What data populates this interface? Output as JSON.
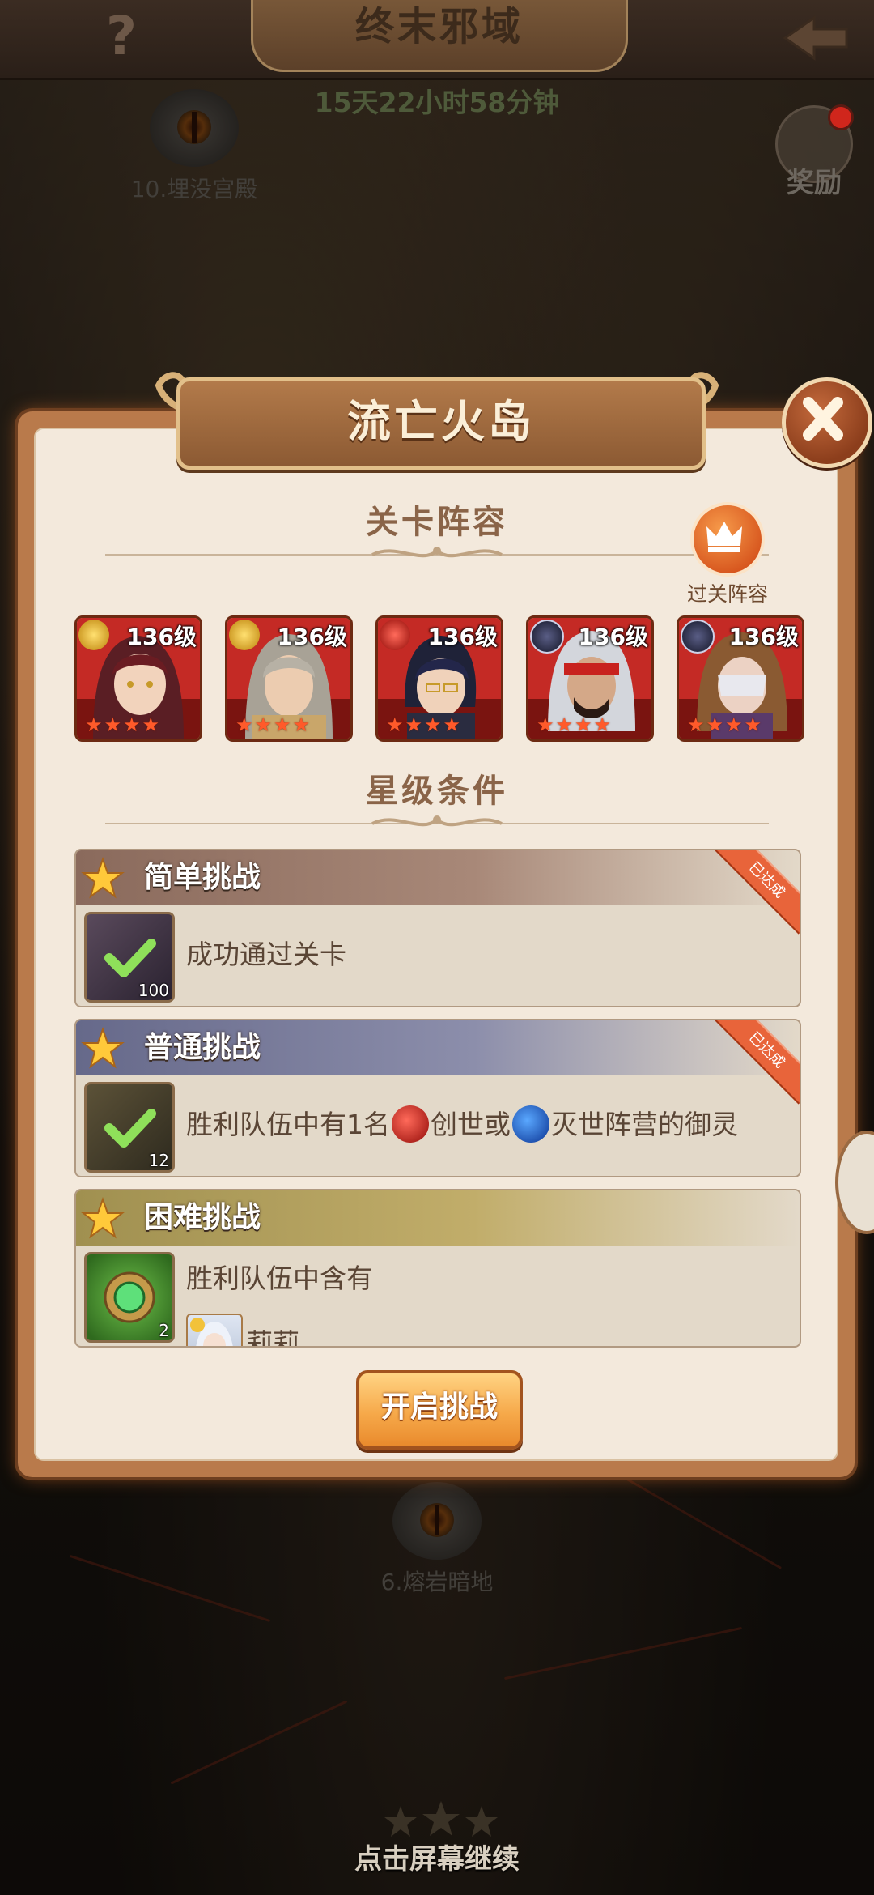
{
  "header": {
    "title": "终末邪域",
    "help_symbol": "?",
    "timer": "15天22小时58分钟"
  },
  "map": {
    "nodes": [
      {
        "label": "10.埋没宫殿"
      },
      {
        "label": "6.熔岩暗地"
      }
    ],
    "reward_label": "奖励",
    "continue_tip": "点击屏幕继续"
  },
  "dialog": {
    "title": "流亡火岛",
    "lineup_heading": "关卡阵容",
    "clear_lineup_label": "过关阵容",
    "star_heading": "星级条件",
    "heroes": [
      {
        "level": "136级",
        "faction": "gold",
        "stars": 4
      },
      {
        "level": "136级",
        "faction": "gold",
        "stars": 4
      },
      {
        "level": "136级",
        "faction": "red",
        "stars": 4
      },
      {
        "level": "136级",
        "faction": "dark",
        "stars": 4
      },
      {
        "level": "136级",
        "faction": "dark",
        "stars": 4
      }
    ],
    "challenges": [
      {
        "title": "简单挑战",
        "completed": true,
        "ribbon": "已达成",
        "item_count": "100",
        "text": "成功通过关卡"
      },
      {
        "title": "普通挑战",
        "completed": true,
        "ribbon": "已达成",
        "item_count": "12",
        "text_before": "胜利队伍中有1名",
        "faction_a": "创世",
        "text_mid": "或",
        "faction_b": "灭世阵营的御灵"
      },
      {
        "title": "困难挑战",
        "completed": false,
        "item_count": "2",
        "text": "胜利队伍中含有",
        "hero_name": "莉莉"
      }
    ],
    "start_button": "开启挑战"
  },
  "colors": {
    "dialog_border": "#b97a4b",
    "panel": "#f3e9dc",
    "accent_orange": "#f6a94a",
    "ribbon": "#e8643a",
    "star_red": "#ff5a2a"
  }
}
